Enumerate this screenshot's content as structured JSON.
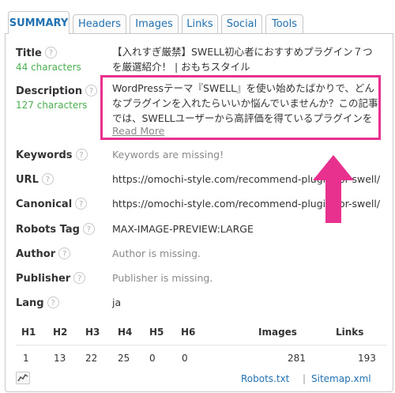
{
  "tabs": [
    {
      "label": "SUMMARY",
      "active": true
    },
    {
      "label": "Headers",
      "active": false
    },
    {
      "label": "Images",
      "active": false
    },
    {
      "label": "Links",
      "active": false
    },
    {
      "label": "Social",
      "active": false
    },
    {
      "label": "Tools",
      "active": false
    }
  ],
  "help_glyph": "?",
  "summary": {
    "title": {
      "label": "Title",
      "count": "44 characters",
      "value": "【入れすぎ厳禁】SWELL初心者におすすめプラグイン７つを厳選紹介！ | おもちスタイル"
    },
    "description": {
      "label": "Description",
      "count": "127 characters",
      "value": "WordPressテーマ『SWELL』を使い始めたばかりで、どんなプラグインを入れたらいいか悩んでいませんか？この記事では、SWELLユーザーから高評価を得ているプラグインを厳選して紹",
      "read_more": "Read More"
    },
    "keywords": {
      "label": "Keywords",
      "value": "Keywords are missing!"
    },
    "url": {
      "label": "URL",
      "value": "https://omochi-style.com/recommend-plugin-for-swell/"
    },
    "canonical": {
      "label": "Canonical",
      "value": "https://omochi-style.com/recommend-plugin-for-swell/"
    },
    "robots": {
      "label": "Robots Tag",
      "value": "MAX-IMAGE-PREVIEW:LARGE"
    },
    "author": {
      "label": "Author",
      "value": "Author is missing."
    },
    "publisher": {
      "label": "Publisher",
      "value": "Publisher is missing."
    },
    "lang": {
      "label": "Lang",
      "value": "ja"
    }
  },
  "stats": {
    "headers": [
      "H1",
      "H2",
      "H3",
      "H4",
      "H5",
      "H6"
    ],
    "header_values": [
      "1",
      "13",
      "22",
      "25",
      "0",
      "0"
    ],
    "images_label": "Images",
    "images_value": "281",
    "links_label": "Links",
    "links_value": "193"
  },
  "footer": {
    "robots_link": "Robots.txt",
    "separator": "|",
    "sitemap_link": "Sitemap.xml",
    "chart_icon": "chart-line-icon"
  },
  "annotation": {
    "highlight_color": "#e8318f",
    "arrow": "up-arrow"
  }
}
